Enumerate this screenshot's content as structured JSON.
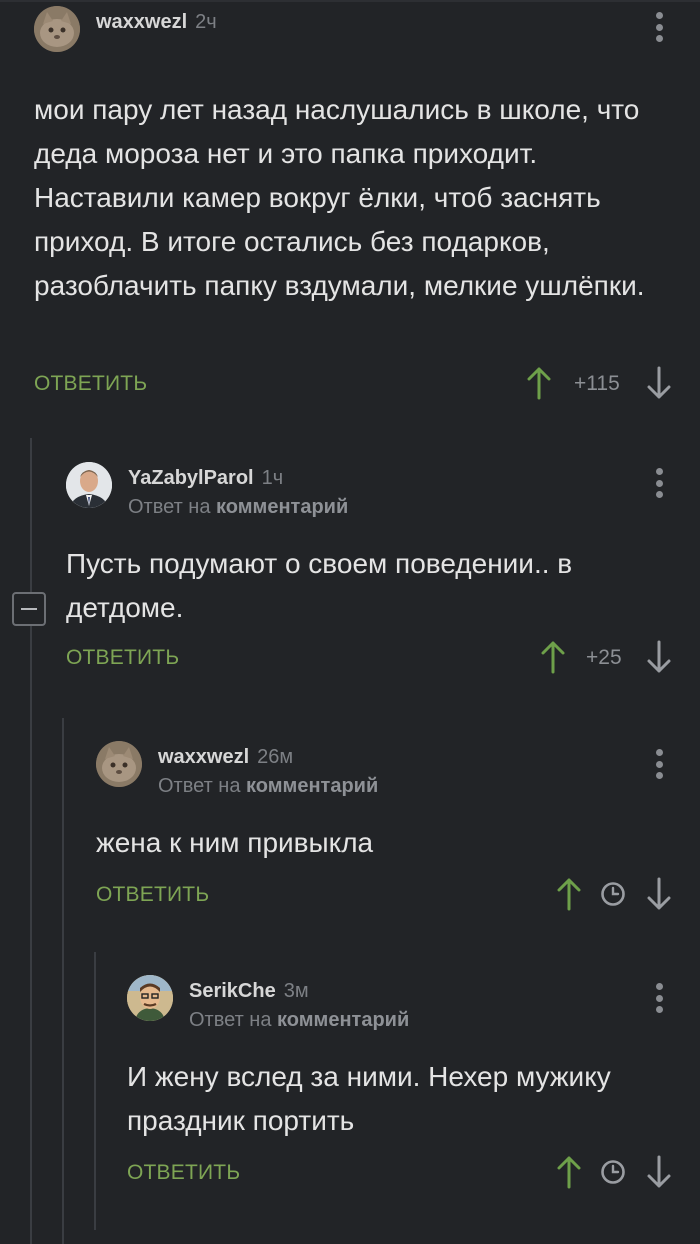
{
  "comments": [
    {
      "username": "waxxwezl",
      "time": "2ч",
      "reply_to_label": "",
      "reply_to_link": "",
      "text": "мои пару лет назад наслушались в школе, что деда мороза нет и это папка приходит. Наставили камер вокруг ёлки, чтоб заснять приход. В итоге остались без подарков, разоблачить папку вздумали, мелкие ушлёпки.",
      "reply_label": "ОТВЕТИТЬ",
      "score": "+115",
      "avatar_icon": "cat-avatar"
    },
    {
      "username": "YaZabylParol",
      "time": "1ч",
      "reply_to_label": "Ответ на",
      "reply_to_link": "комментарий",
      "text": "Пусть подумают о своем поведении.. в детдоме.",
      "reply_label": "ОТВЕТИТЬ",
      "score": "+25",
      "avatar_icon": "man-in-suit-avatar"
    },
    {
      "username": "waxxwezl",
      "time": "26м",
      "reply_to_label": "Ответ на",
      "reply_to_link": "комментарий",
      "text": "жена к ним привыкла",
      "reply_label": "ОТВЕТИТЬ",
      "score": "",
      "avatar_icon": "cat-avatar"
    },
    {
      "username": "SerikChe",
      "time": "3м",
      "reply_to_label": "Ответ на",
      "reply_to_link": "комментарий",
      "text": "И жену вслед за ними. Нехер мужику праздник портить",
      "reply_label": "ОТВЕТИТЬ",
      "score": "",
      "avatar_icon": "cartoon-man-avatar"
    }
  ],
  "colors": {
    "background": "#222427",
    "reply_green": "#7ea554",
    "upvote_green": "#6ea04a",
    "muted": "#7d8085"
  },
  "icons": [
    "upvote-arrow-icon",
    "downvote-arrow-icon",
    "clock-icon",
    "more-vertical-icon",
    "collapse-minus-icon"
  ]
}
